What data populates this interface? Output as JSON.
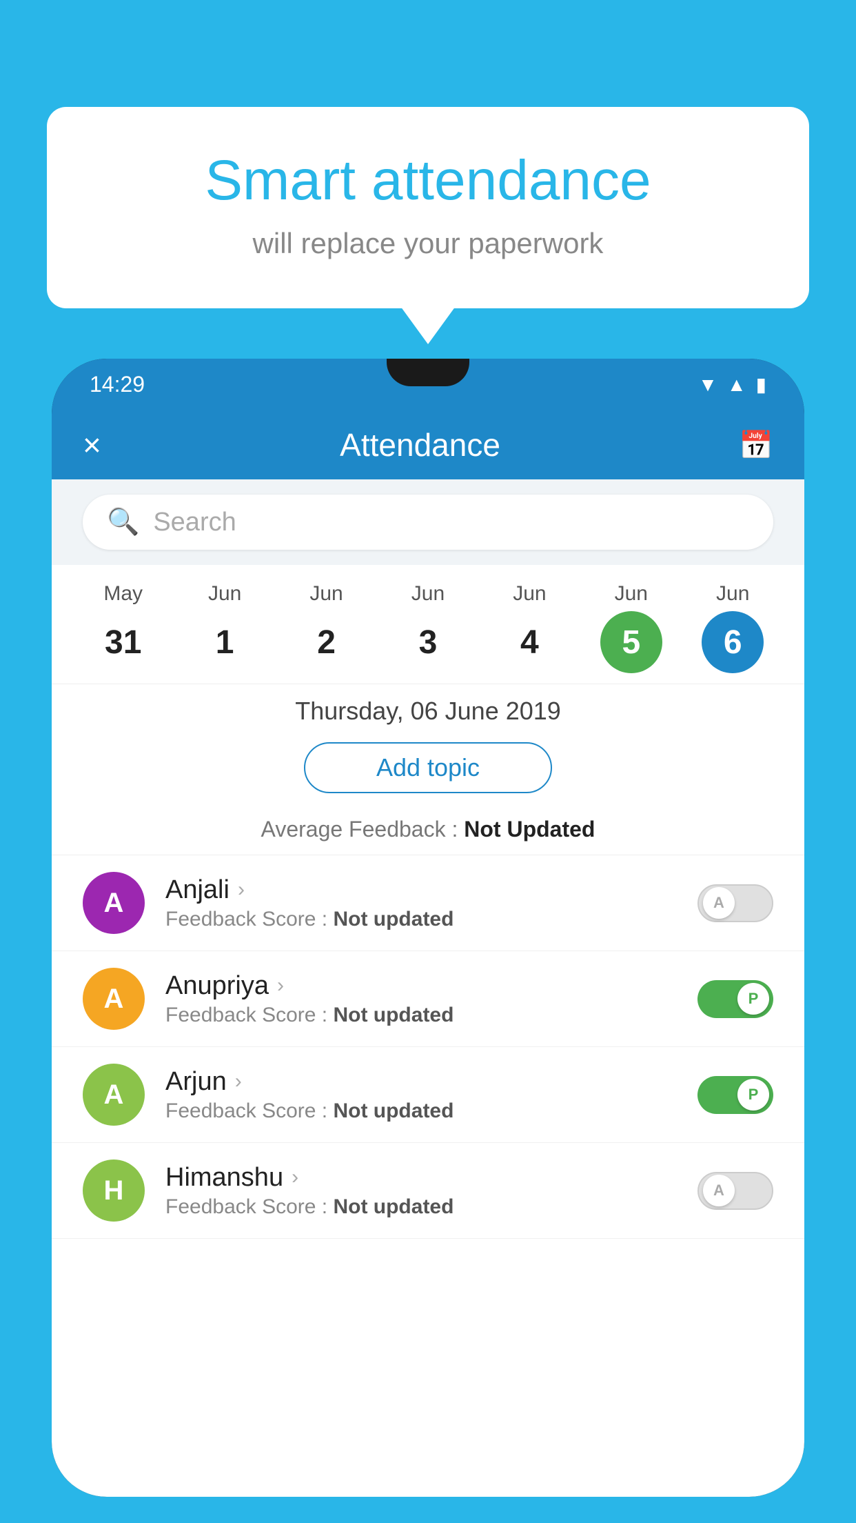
{
  "background_color": "#29b6e8",
  "bubble": {
    "title": "Smart attendance",
    "subtitle": "will replace your paperwork"
  },
  "phone": {
    "status_bar": {
      "time": "14:29",
      "icons": [
        "wifi",
        "signal",
        "battery"
      ]
    },
    "header": {
      "title": "Attendance",
      "close_label": "×",
      "calendar_icon": "📅"
    },
    "search": {
      "placeholder": "Search"
    },
    "calendar": {
      "days": [
        {
          "month": "May",
          "date": "31",
          "state": "normal"
        },
        {
          "month": "Jun",
          "date": "1",
          "state": "normal"
        },
        {
          "month": "Jun",
          "date": "2",
          "state": "normal"
        },
        {
          "month": "Jun",
          "date": "3",
          "state": "normal"
        },
        {
          "month": "Jun",
          "date": "4",
          "state": "normal"
        },
        {
          "month": "Jun",
          "date": "5",
          "state": "today"
        },
        {
          "month": "Jun",
          "date": "6",
          "state": "selected"
        }
      ]
    },
    "selected_date": "Thursday, 06 June 2019",
    "add_topic_label": "Add topic",
    "avg_feedback_label": "Average Feedback : ",
    "avg_feedback_value": "Not Updated",
    "students": [
      {
        "name": "Anjali",
        "avatar_letter": "A",
        "avatar_color": "#9c27b0",
        "feedback_score": "Not updated",
        "toggle_state": "off",
        "toggle_label": "A"
      },
      {
        "name": "Anupriya",
        "avatar_letter": "A",
        "avatar_color": "#f5a623",
        "feedback_score": "Not updated",
        "toggle_state": "on",
        "toggle_label": "P"
      },
      {
        "name": "Arjun",
        "avatar_letter": "A",
        "avatar_color": "#8bc34a",
        "feedback_score": "Not updated",
        "toggle_state": "on",
        "toggle_label": "P"
      },
      {
        "name": "Himanshu",
        "avatar_letter": "H",
        "avatar_color": "#8bc34a",
        "feedback_score": "Not updated",
        "toggle_state": "off",
        "toggle_label": "A"
      }
    ]
  }
}
